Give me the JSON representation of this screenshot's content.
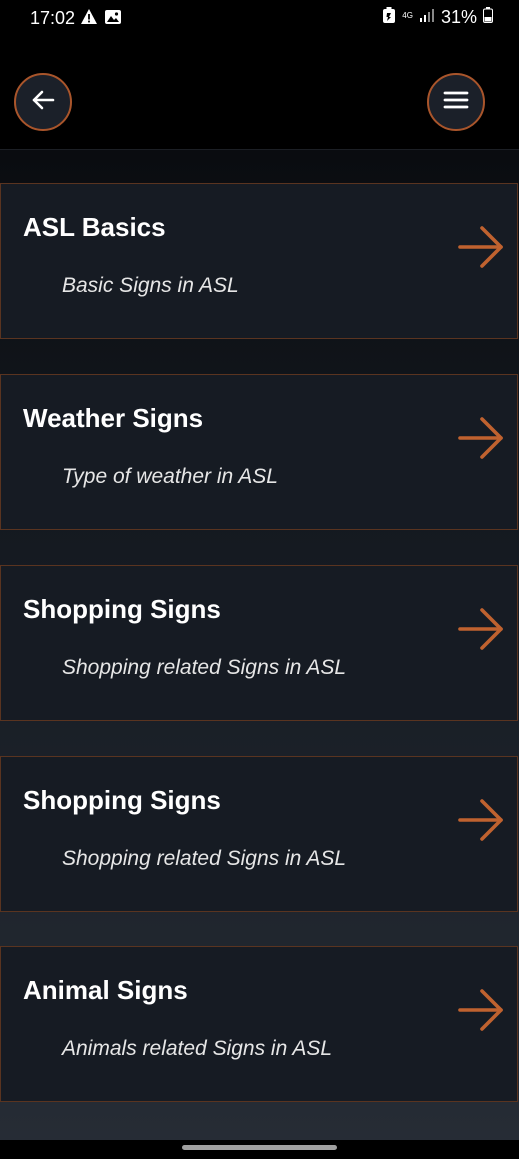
{
  "status_bar": {
    "time": "17:02",
    "network": "4G",
    "battery": "31%",
    "left_icons": [
      "warning-icon",
      "image-icon"
    ],
    "right_icons": [
      "battery-saver-icon",
      "signal-icon",
      "battery-icon"
    ]
  },
  "top_bar": {
    "back_icon": "arrow-left-icon",
    "menu_icon": "hamburger-menu-icon"
  },
  "colors": {
    "accent": "#c0622f",
    "card_background": "#161b23",
    "page_background": "#000000"
  },
  "cards": [
    {
      "title": "ASL Basics",
      "subtitle": "Basic Signs in ASL",
      "arrow_icon": "arrow-right-icon"
    },
    {
      "title": "Weather Signs",
      "subtitle": "Type of weather in ASL",
      "arrow_icon": "arrow-right-icon"
    },
    {
      "title": "Shopping Signs",
      "subtitle": "Shopping related Signs in ASL",
      "arrow_icon": "arrow-right-icon"
    },
    {
      "title": "Shopping Signs",
      "subtitle": "Shopping related Signs in ASL",
      "arrow_icon": "arrow-right-icon"
    },
    {
      "title": "Animal Signs",
      "subtitle": "Animals related Signs in ASL",
      "arrow_icon": "arrow-right-icon"
    }
  ]
}
